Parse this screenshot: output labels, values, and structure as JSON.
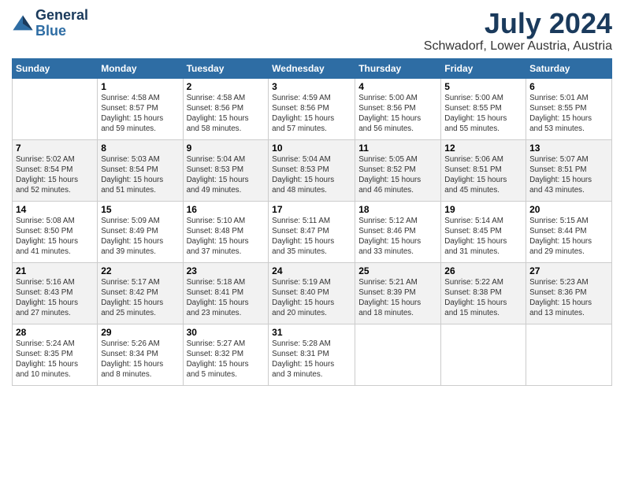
{
  "logo": {
    "line1": "General",
    "line2": "Blue"
  },
  "title": "July 2024",
  "location": "Schwadorf, Lower Austria, Austria",
  "days_of_week": [
    "Sunday",
    "Monday",
    "Tuesday",
    "Wednesday",
    "Thursday",
    "Friday",
    "Saturday"
  ],
  "weeks": [
    [
      {
        "day": "",
        "info": ""
      },
      {
        "day": "1",
        "info": "Sunrise: 4:58 AM\nSunset: 8:57 PM\nDaylight: 15 hours\nand 59 minutes."
      },
      {
        "day": "2",
        "info": "Sunrise: 4:58 AM\nSunset: 8:56 PM\nDaylight: 15 hours\nand 58 minutes."
      },
      {
        "day": "3",
        "info": "Sunrise: 4:59 AM\nSunset: 8:56 PM\nDaylight: 15 hours\nand 57 minutes."
      },
      {
        "day": "4",
        "info": "Sunrise: 5:00 AM\nSunset: 8:56 PM\nDaylight: 15 hours\nand 56 minutes."
      },
      {
        "day": "5",
        "info": "Sunrise: 5:00 AM\nSunset: 8:55 PM\nDaylight: 15 hours\nand 55 minutes."
      },
      {
        "day": "6",
        "info": "Sunrise: 5:01 AM\nSunset: 8:55 PM\nDaylight: 15 hours\nand 53 minutes."
      }
    ],
    [
      {
        "day": "7",
        "info": "Sunrise: 5:02 AM\nSunset: 8:54 PM\nDaylight: 15 hours\nand 52 minutes."
      },
      {
        "day": "8",
        "info": "Sunrise: 5:03 AM\nSunset: 8:54 PM\nDaylight: 15 hours\nand 51 minutes."
      },
      {
        "day": "9",
        "info": "Sunrise: 5:04 AM\nSunset: 8:53 PM\nDaylight: 15 hours\nand 49 minutes."
      },
      {
        "day": "10",
        "info": "Sunrise: 5:04 AM\nSunset: 8:53 PM\nDaylight: 15 hours\nand 48 minutes."
      },
      {
        "day": "11",
        "info": "Sunrise: 5:05 AM\nSunset: 8:52 PM\nDaylight: 15 hours\nand 46 minutes."
      },
      {
        "day": "12",
        "info": "Sunrise: 5:06 AM\nSunset: 8:51 PM\nDaylight: 15 hours\nand 45 minutes."
      },
      {
        "day": "13",
        "info": "Sunrise: 5:07 AM\nSunset: 8:51 PM\nDaylight: 15 hours\nand 43 minutes."
      }
    ],
    [
      {
        "day": "14",
        "info": "Sunrise: 5:08 AM\nSunset: 8:50 PM\nDaylight: 15 hours\nand 41 minutes."
      },
      {
        "day": "15",
        "info": "Sunrise: 5:09 AM\nSunset: 8:49 PM\nDaylight: 15 hours\nand 39 minutes."
      },
      {
        "day": "16",
        "info": "Sunrise: 5:10 AM\nSunset: 8:48 PM\nDaylight: 15 hours\nand 37 minutes."
      },
      {
        "day": "17",
        "info": "Sunrise: 5:11 AM\nSunset: 8:47 PM\nDaylight: 15 hours\nand 35 minutes."
      },
      {
        "day": "18",
        "info": "Sunrise: 5:12 AM\nSunset: 8:46 PM\nDaylight: 15 hours\nand 33 minutes."
      },
      {
        "day": "19",
        "info": "Sunrise: 5:14 AM\nSunset: 8:45 PM\nDaylight: 15 hours\nand 31 minutes."
      },
      {
        "day": "20",
        "info": "Sunrise: 5:15 AM\nSunset: 8:44 PM\nDaylight: 15 hours\nand 29 minutes."
      }
    ],
    [
      {
        "day": "21",
        "info": "Sunrise: 5:16 AM\nSunset: 8:43 PM\nDaylight: 15 hours\nand 27 minutes."
      },
      {
        "day": "22",
        "info": "Sunrise: 5:17 AM\nSunset: 8:42 PM\nDaylight: 15 hours\nand 25 minutes."
      },
      {
        "day": "23",
        "info": "Sunrise: 5:18 AM\nSunset: 8:41 PM\nDaylight: 15 hours\nand 23 minutes."
      },
      {
        "day": "24",
        "info": "Sunrise: 5:19 AM\nSunset: 8:40 PM\nDaylight: 15 hours\nand 20 minutes."
      },
      {
        "day": "25",
        "info": "Sunrise: 5:21 AM\nSunset: 8:39 PM\nDaylight: 15 hours\nand 18 minutes."
      },
      {
        "day": "26",
        "info": "Sunrise: 5:22 AM\nSunset: 8:38 PM\nDaylight: 15 hours\nand 15 minutes."
      },
      {
        "day": "27",
        "info": "Sunrise: 5:23 AM\nSunset: 8:36 PM\nDaylight: 15 hours\nand 13 minutes."
      }
    ],
    [
      {
        "day": "28",
        "info": "Sunrise: 5:24 AM\nSunset: 8:35 PM\nDaylight: 15 hours\nand 10 minutes."
      },
      {
        "day": "29",
        "info": "Sunrise: 5:26 AM\nSunset: 8:34 PM\nDaylight: 15 hours\nand 8 minutes."
      },
      {
        "day": "30",
        "info": "Sunrise: 5:27 AM\nSunset: 8:32 PM\nDaylight: 15 hours\nand 5 minutes."
      },
      {
        "day": "31",
        "info": "Sunrise: 5:28 AM\nSunset: 8:31 PM\nDaylight: 15 hours\nand 3 minutes."
      },
      {
        "day": "",
        "info": ""
      },
      {
        "day": "",
        "info": ""
      },
      {
        "day": "",
        "info": ""
      }
    ]
  ]
}
